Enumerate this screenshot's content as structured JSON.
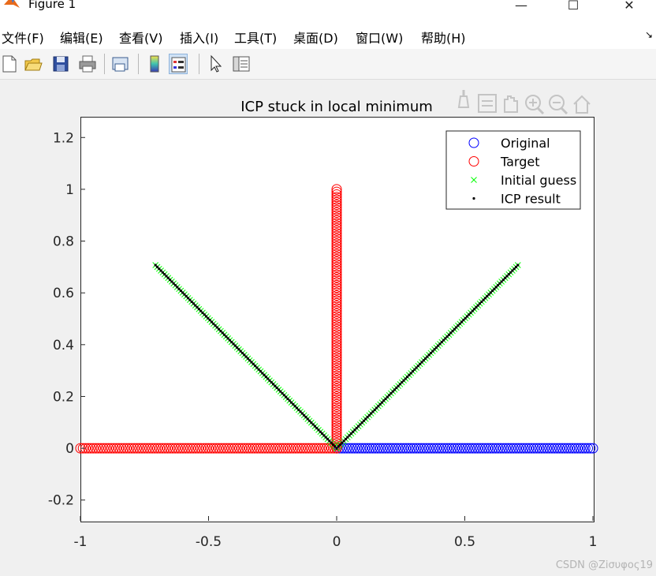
{
  "window": {
    "title": "Figure 1",
    "minimize": "—",
    "maximize": "☐",
    "close": "✕"
  },
  "menu": [
    "文件(F)",
    "编辑(E)",
    "查看(V)",
    "插入(I)",
    "工具(T)",
    "桌面(D)",
    "窗口(W)",
    "帮助(H)"
  ],
  "menu_arrow": "↘",
  "toolbar_icons": [
    "new-figure-icon",
    "open-file-icon",
    "save-icon",
    "print-icon",
    "link-plot-icon",
    "colorbar-icon",
    "legend-icon",
    "pointer-icon",
    "property-editor-icon"
  ],
  "axes_toolbar_icons": [
    "brush-icon",
    "data-tips-icon",
    "pan-icon",
    "zoom-in-icon",
    "zoom-out-icon",
    "home-icon"
  ],
  "colors": {
    "original": "#0000ff",
    "target": "#ff0000",
    "initial": "#00ff00",
    "icp": "#000000"
  },
  "watermark": "CSDN @Ziσυφος19",
  "chart_data": {
    "type": "scatter",
    "title": "ICP stuck in local minimum",
    "xlim": [
      -1,
      1
    ],
    "ylim": [
      -0.28,
      1.28
    ],
    "xticks": [
      -1,
      -0.5,
      0,
      0.5,
      1
    ],
    "xtick_labels": [
      "-1",
      "-0.5",
      "0",
      "0.5",
      "1"
    ],
    "yticks": [
      -0.2,
      0,
      0.2,
      0.4,
      0.6,
      0.8,
      1,
      1.2
    ],
    "ytick_labels": [
      "-0.2",
      "0",
      "0.2",
      "0.4",
      "0.6",
      "0.8",
      "1",
      "1.2"
    ],
    "grid": false,
    "legend_position": "top-right",
    "series": [
      {
        "name": "Original",
        "marker": "circle",
        "color": "#0000ff",
        "description": "101 points along y = 0, x from 0 to 1",
        "segments": [
          {
            "from": [
              0,
              0
            ],
            "to": [
              1,
              0
            ],
            "points": 101
          }
        ]
      },
      {
        "name": "Target",
        "marker": "circle",
        "color": "#ff0000",
        "description": "101 points along x = 0 (y 0→1) and 101 points along y = 0 (x -1→0)",
        "segments": [
          {
            "from": [
              0,
              0
            ],
            "to": [
              0,
              1
            ],
            "points": 101
          },
          {
            "from": [
              0,
              0
            ],
            "to": [
              -1,
              0
            ],
            "points": 101
          }
        ]
      },
      {
        "name": "Initial guess",
        "marker": "x",
        "color": "#00ff00",
        "segments": [
          {
            "from": [
              0,
              0
            ],
            "to": [
              0.7071,
              0.7071
            ],
            "points": 101
          },
          {
            "from": [
              0,
              0
            ],
            "to": [
              -0.7071,
              0.7071
            ],
            "points": 101
          }
        ]
      },
      {
        "name": "ICP result",
        "marker": "dot",
        "color": "#000000",
        "segments": [
          {
            "from": [
              0,
              0
            ],
            "to": [
              0.7071,
              0.7071
            ],
            "points": 101
          },
          {
            "from": [
              0,
              0
            ],
            "to": [
              -0.7071,
              0.7071
            ],
            "points": 101
          }
        ]
      }
    ]
  }
}
